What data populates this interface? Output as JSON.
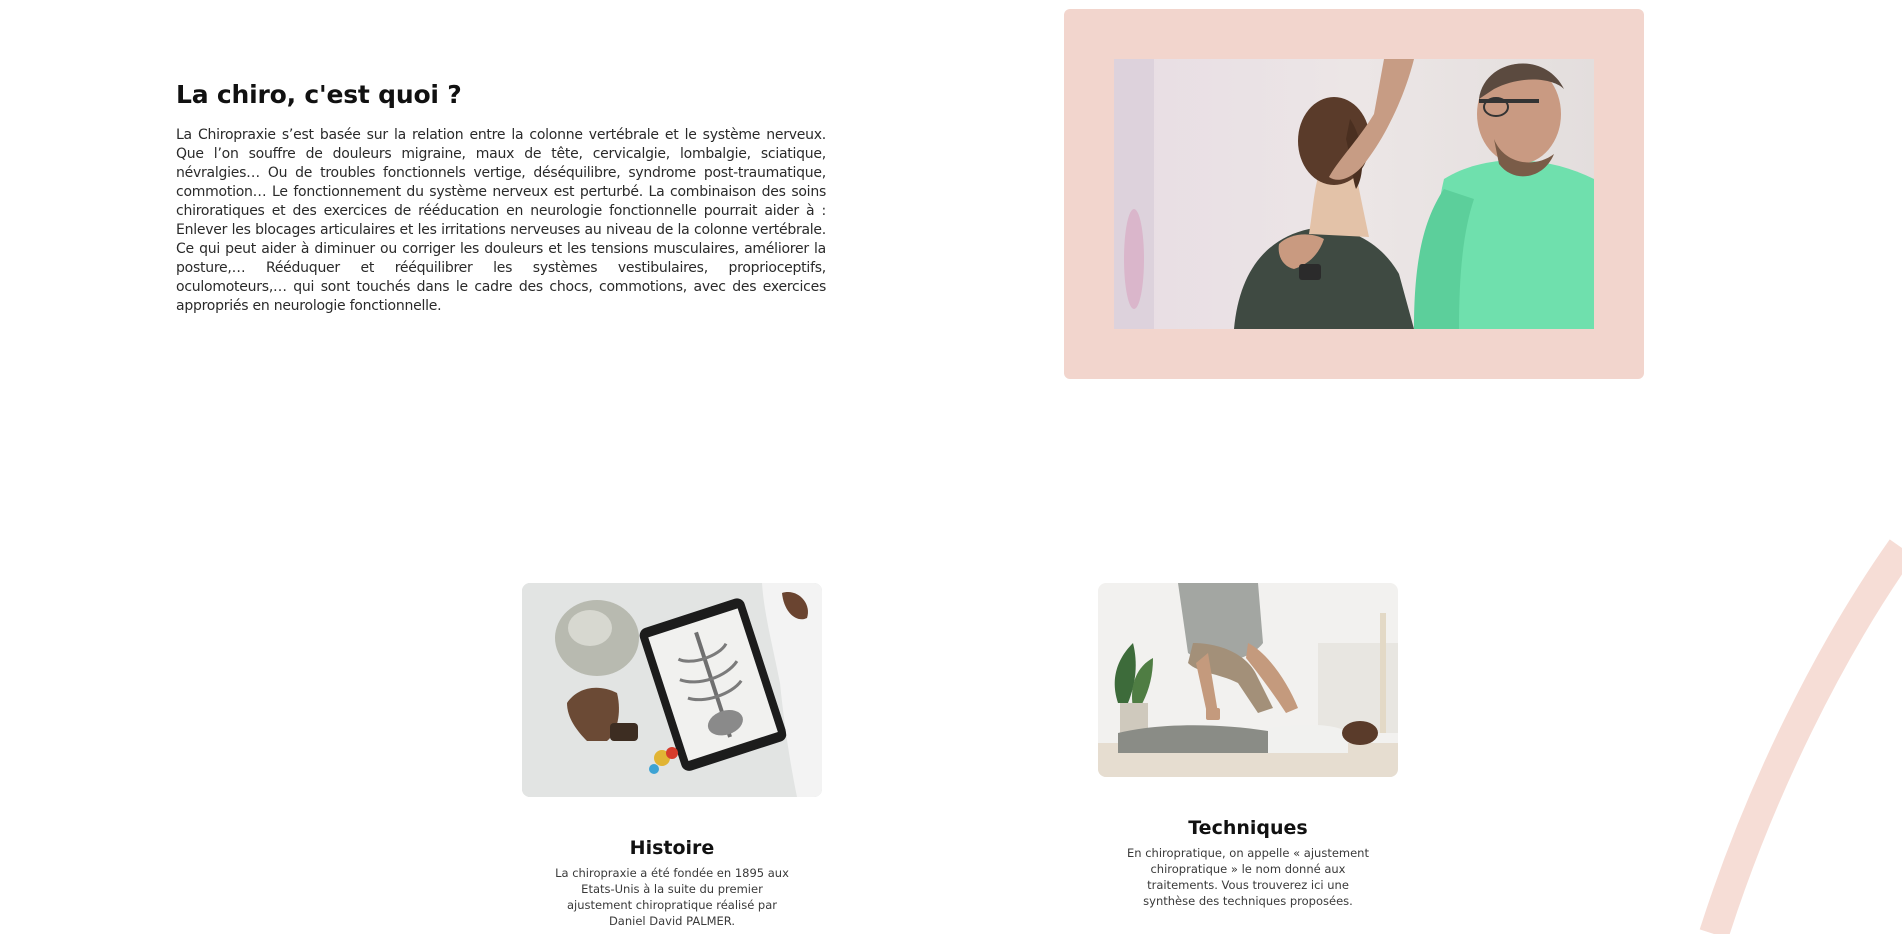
{
  "intro": {
    "title": "La chiro, c'est quoi ?",
    "body": "La Chiropraxie s’est basée sur la relation entre la colonne vertébrale et le système nerveux. Que l’on souffre de douleurs migraine, maux de tête, cervicalgie, lombalgie, sciatique, névralgies… Ou de troubles fonctionnels vertige, déséquilibre, syndrome post-traumatique, commotion… Le fonctionnement du système nerveux est perturbé. La combinaison des soins chiroratiques et des exercices de rééducation en neurologie fonctionnelle pourrait aider à : Enlever les blocages articulaires et les irritations nerveuses au niveau de la colonne vertébrale. Ce qui peut aider à diminuer ou corriger les douleurs et les tensions musculaires, améliorer la posture,… Rééduquer et rééquilibrer les systèmes vestibulaires, proprioceptifs, oculomoteurs,… qui sont touchés dans le cadre des chocs, commotions, avec des exercices appropriés en neurologie fonctionnelle."
  },
  "cards": [
    {
      "title": "Histoire",
      "text": "La chiropraxie a été fondée en 1895 aux Etats-Unis à la suite du premier ajustement chiropratique réalisé par Daniel David PALMER."
    },
    {
      "title": "Techniques",
      "text": "En chiropratique, on appelle « ajustement chiropratique » le nom donné aux traitements. Vous trouverez ici une synthèse des techniques proposées."
    }
  ],
  "colors": {
    "frame": "#f2d5cd",
    "accent_arc": "#f6ddd6"
  }
}
